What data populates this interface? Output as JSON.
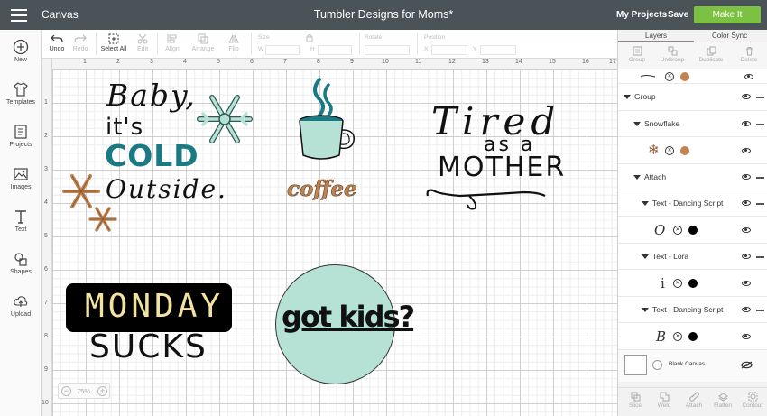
{
  "topbar": {
    "app_title": "Canvas",
    "doc_title": "Tumbler Designs for Moms*",
    "my_projects": "My Projects",
    "save": "Save",
    "make_it": "Make It"
  },
  "sidebar": [
    {
      "label": "New",
      "icon": "plus-circle-icon"
    },
    {
      "label": "Templates",
      "icon": "tshirt-icon"
    },
    {
      "label": "Projects",
      "icon": "projects-icon"
    },
    {
      "label": "Images",
      "icon": "image-icon"
    },
    {
      "label": "Text",
      "icon": "text-t-icon"
    },
    {
      "label": "Shapes",
      "icon": "shapes-icon"
    },
    {
      "label": "Upload",
      "icon": "upload-cloud-icon"
    }
  ],
  "toolbar": {
    "undo": "Undo",
    "redo": "Redo",
    "select_all": "Select All",
    "edit": "Edit",
    "align": "Align",
    "arrange": "Arrange",
    "flip": "Flip",
    "size": "Size",
    "w": "W",
    "h": "H",
    "rotate": "Rotate",
    "position": "Position",
    "x": "X",
    "y": "Y"
  },
  "rulers": {
    "top": [
      "1",
      "2",
      "3",
      "4",
      "5",
      "6",
      "7",
      "8",
      "9",
      "10",
      "11",
      "12",
      "13",
      "14",
      "15",
      "16",
      "17"
    ],
    "left": [
      "1",
      "2",
      "3",
      "4",
      "5",
      "6",
      "7",
      "8",
      "9",
      "10"
    ]
  },
  "canvas": {
    "baby": {
      "line1": "Baby,",
      "line2": "it's",
      "line3": "COLD",
      "line4": "Outside."
    },
    "coffee": {
      "word": "coffee"
    },
    "tired": {
      "line1": "Tired",
      "line2": "as a",
      "line3": "MOTHER"
    },
    "monday": {
      "line1": "MONDAY",
      "line2": "SUCKS"
    },
    "gotkids": {
      "text": "got kids?"
    },
    "zoom": "75%"
  },
  "colors": {
    "teal": "#1a7a83",
    "mint": "#b6e2d6",
    "mint_dark": "#2f5a55",
    "copper": "#c08452",
    "monday_yellow": "#f3e3a0",
    "make_green": "#7cc142",
    "topbar": "#4a5358"
  },
  "panel": {
    "tab_layers": "Layers",
    "tab_color_sync": "Color Sync",
    "tools": [
      "Group",
      "UnGroup",
      "Duplicate",
      "Delete"
    ],
    "layers": {
      "group": "Group",
      "snowflake": "Snowflake",
      "attach": "Attach",
      "text_dancing_1": "Text - Dancing Script",
      "text_lora": "Text - Lora",
      "text_dancing_2": "Text - Dancing Script",
      "glyph_o": "O",
      "glyph_i": "i",
      "glyph_b": "B"
    },
    "blank_canvas": "Blank Canvas",
    "bottom_tools": [
      "Slice",
      "Weld",
      "Attach",
      "Flatten",
      "Contour"
    ]
  }
}
